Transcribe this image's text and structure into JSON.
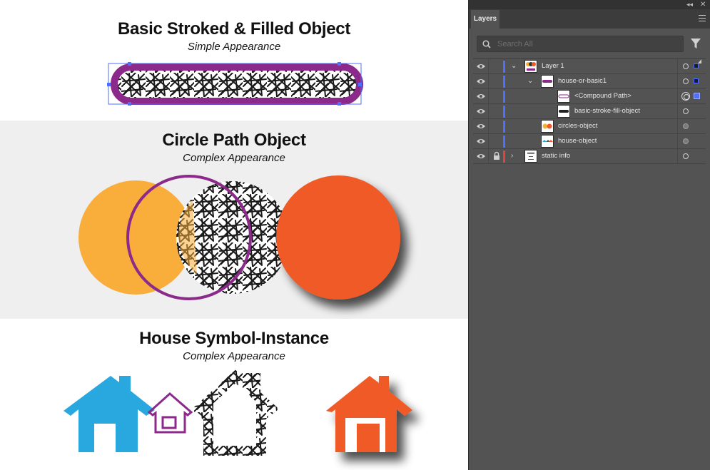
{
  "artboard": {
    "sections": [
      {
        "title": "Basic Stroked & Filled Object",
        "subtitle": "Simple Appearance"
      },
      {
        "title": "Circle Path Object",
        "subtitle": "Complex Appearance"
      },
      {
        "title": "House Symbol-Instance",
        "subtitle": "Complex Appearance"
      }
    ]
  },
  "panel": {
    "tab_label": "Layers",
    "search_placeholder": "Search All",
    "layers": [
      {
        "name": "Layer 1",
        "indent": 0,
        "chevron": "down",
        "color": "#4e6fff",
        "target": "empty",
        "selected": true
      },
      {
        "name": "house-or-basic1",
        "indent": 1,
        "chevron": "down",
        "color": "#4e6fff",
        "target": "empty",
        "selected": true
      },
      {
        "name": "<Compound Path>",
        "indent": 2,
        "chevron": "",
        "color": "#4e6fff",
        "target": "double",
        "selected_big": true
      },
      {
        "name": "basic-stroke-fill-object",
        "indent": 2,
        "chevron": "",
        "color": "#4e6fff",
        "target": "empty"
      },
      {
        "name": "circles-object",
        "indent": 1,
        "chevron": "",
        "color": "#4e6fff",
        "target": "filled"
      },
      {
        "name": "house-object",
        "indent": 1,
        "chevron": "",
        "color": "#4e6fff",
        "target": "filled"
      },
      {
        "name": "static info",
        "indent": 0,
        "chevron": "right",
        "color": "#e6413b",
        "target": "empty",
        "locked": true
      }
    ]
  },
  "colors": {
    "purple": "#8b2a8b",
    "orange_light": "#f9ad3b",
    "orange_red": "#f05a28",
    "blue": "#29a8e0",
    "selection_blue": "#4e6fff"
  }
}
